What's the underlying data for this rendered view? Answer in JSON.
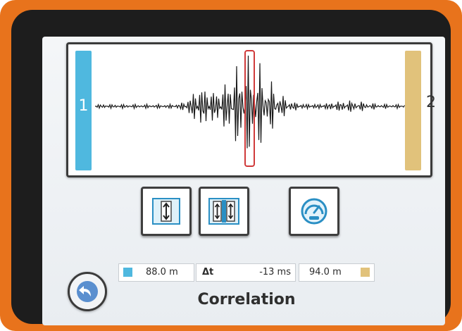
{
  "screen": {
    "title": "Correlation"
  },
  "sensors": {
    "left": {
      "label": "1",
      "color": "#4fb8df",
      "distance": "88.0 m"
    },
    "right": {
      "label": "2",
      "color": "#e1c27b",
      "distance": "94.0 m"
    }
  },
  "delta": {
    "label": "Δt",
    "value": "-13 ms"
  },
  "buttons": [
    {
      "name": "single-cursor",
      "icon": "single-arrow-icon"
    },
    {
      "name": "dual-cursor",
      "icon": "double-arrow-icon"
    },
    {
      "name": "speed",
      "icon": "speedometer-icon"
    }
  ],
  "colors": {
    "frame": "#e8731c",
    "marker": "#d03a3a"
  }
}
